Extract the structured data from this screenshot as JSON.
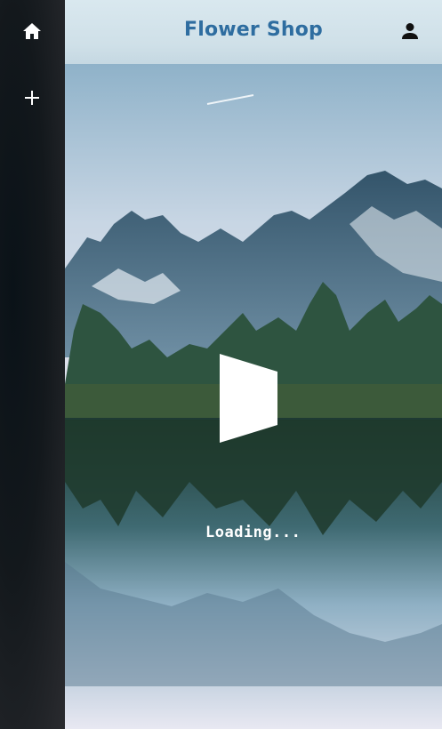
{
  "sidebar": {
    "items": [
      {
        "name": "home",
        "icon": "home-icon"
      },
      {
        "name": "add",
        "icon": "plus-icon"
      }
    ]
  },
  "header": {
    "title": "Flower Shop",
    "user_icon": "user-icon"
  },
  "main": {
    "loading_text": "Loading...",
    "play_icon": "play-icon"
  },
  "colors": {
    "title": "#2e6da0",
    "sidebar": "#1c1f22",
    "header_bg": "#d2e3eb"
  }
}
